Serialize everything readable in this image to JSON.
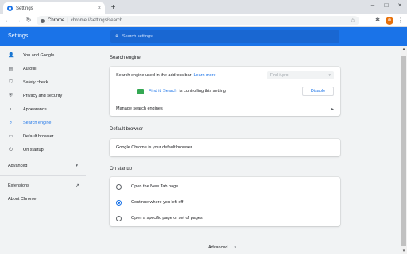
{
  "tab": {
    "title": "Settings",
    "close": "×"
  },
  "newtab": "+",
  "window": {
    "minimize": "–",
    "maximize": "□",
    "close": "×"
  },
  "toolbar": {
    "back": "←",
    "forward": "→",
    "reload": "↻",
    "origin": "Chrome",
    "separator": "|",
    "url": "chrome://settings/search",
    "star": "☆",
    "extensions": "✱",
    "menu": "⋮"
  },
  "header": {
    "title": "Settings",
    "search_placeholder": "Search settings"
  },
  "sidebar": {
    "items": [
      {
        "label": "You and Google",
        "icon": "person-icon",
        "glyph": "👤"
      },
      {
        "label": "Autofill",
        "icon": "clipboard-icon",
        "glyph": "▤"
      },
      {
        "label": "Safety check",
        "icon": "shield-icon",
        "glyph": "⛉"
      },
      {
        "label": "Privacy and security",
        "icon": "shield-lock-icon",
        "glyph": "⛨"
      },
      {
        "label": "Appearance",
        "icon": "palette-icon",
        "glyph": "◐"
      },
      {
        "label": "Search engine",
        "icon": "search-icon",
        "glyph": "⌕",
        "active": true
      },
      {
        "label": "Default browser",
        "icon": "browser-icon",
        "glyph": "▭"
      },
      {
        "label": "On startup",
        "icon": "power-icon",
        "glyph": "⏻"
      }
    ],
    "advanced": "Advanced",
    "advanced_arrow": "▾",
    "extensions": "Extensions",
    "extensions_icon": "↗",
    "about": "About Chrome"
  },
  "search_engine": {
    "title": "Search engine",
    "row1_label": "Search engine used in the address bar",
    "row1_link": "Learn more",
    "select_value": "Find-it.pro",
    "select_arrow": "▾",
    "controlled_link": "Find it: Search",
    "controlled_text": "is controlling this setting",
    "disable_button": "Disable",
    "manage_label": "Manage search engines",
    "manage_arrow": "▸"
  },
  "default_browser": {
    "title": "Default browser",
    "text": "Google Chrome is your default browser"
  },
  "on_startup": {
    "title": "On startup",
    "options": [
      {
        "label": "Open the New Tab page",
        "selected": false
      },
      {
        "label": "Continue where you left off",
        "selected": true
      },
      {
        "label": "Open a specific page or set of pages",
        "selected": false
      }
    ]
  },
  "footer": {
    "advanced": "Advanced",
    "arrow": "▾"
  },
  "colors": {
    "accent": "#1a73e8",
    "header_bg": "#1a73e8",
    "search_bg": "#1967d2",
    "page_bg": "#f1f3f4"
  }
}
